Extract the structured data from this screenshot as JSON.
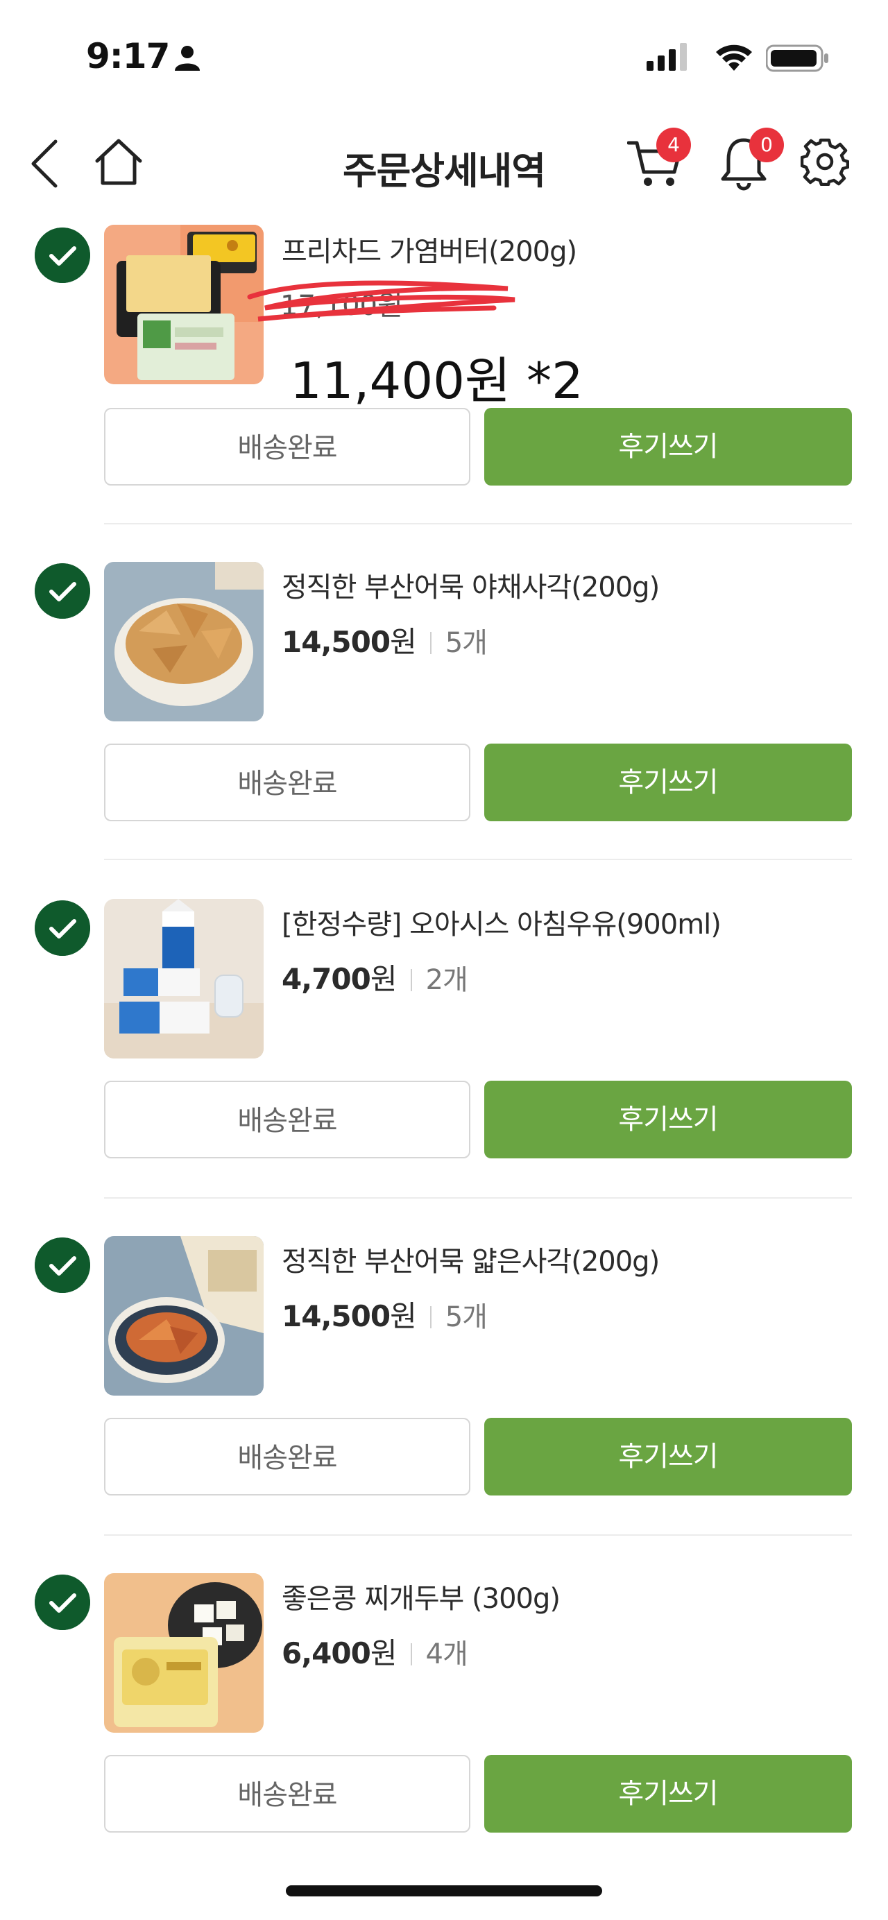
{
  "status_bar": {
    "time": "9:17"
  },
  "header": {
    "title": "주문상세내역",
    "cart_count": "4",
    "notification_count": "0"
  },
  "items": [
    {
      "name": "프리차드 가염버터(200g)",
      "original_price": "17,100원",
      "price": "11,400원 *2",
      "status_label": "배송완료",
      "review_label": "후기쓰기"
    },
    {
      "name": "정직한 부산어묵 야채사각(200g)",
      "price": "14,500",
      "unit": "원",
      "quantity": "5개",
      "status_label": "배송완료",
      "review_label": "후기쓰기"
    },
    {
      "name": "[한정수량] 오아시스 아침우유(900ml)",
      "price": "4,700",
      "unit": "원",
      "quantity": "2개",
      "status_label": "배송완료",
      "review_label": "후기쓰기"
    },
    {
      "name": "정직한 부산어묵 얇은사각(200g)",
      "price": "14,500",
      "unit": "원",
      "quantity": "5개",
      "status_label": "배송완료",
      "review_label": "후기쓰기"
    },
    {
      "name": "좋은콩 찌개두부 (300g)",
      "price": "6,400",
      "unit": "원",
      "quantity": "4개",
      "status_label": "배송완료",
      "review_label": "후기쓰기"
    }
  ],
  "colors": {
    "accent_green": "#6aa542",
    "check_green": "#0f5a2c",
    "badge_red": "#e8323c"
  }
}
